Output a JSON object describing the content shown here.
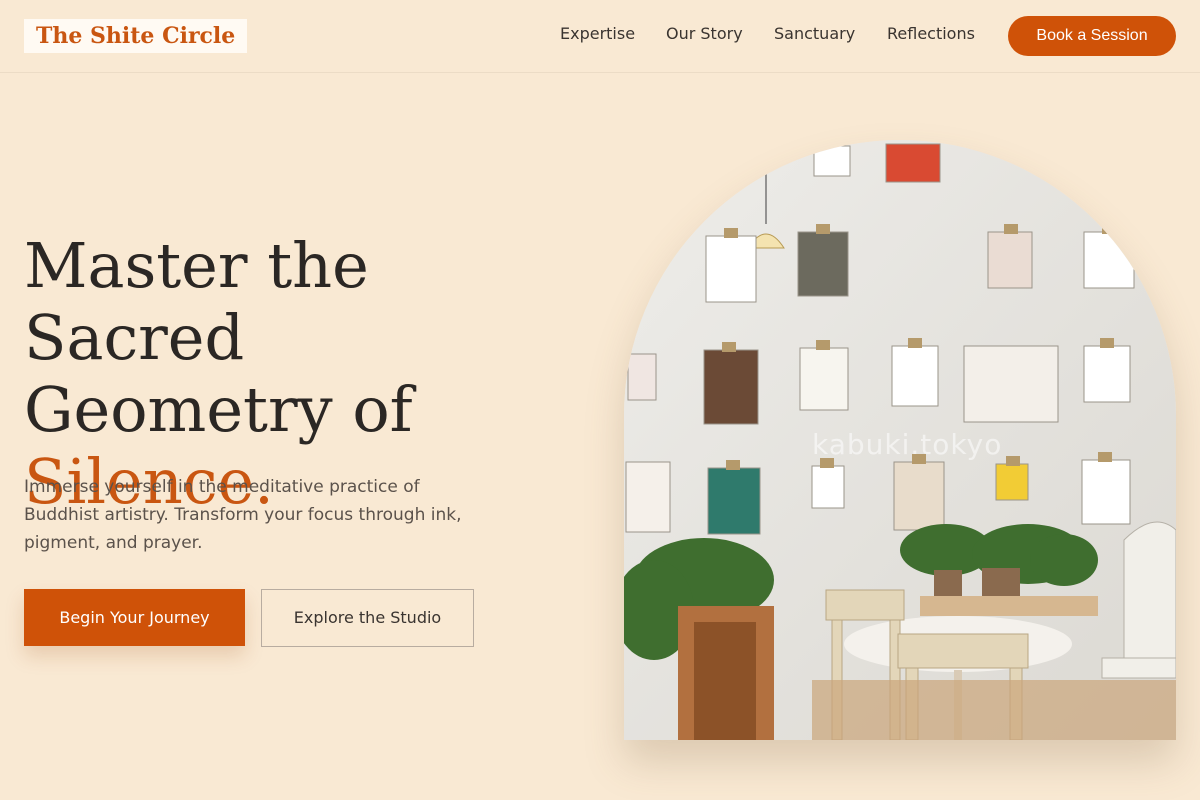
{
  "brand": {
    "name": "The Shite Circle"
  },
  "nav": {
    "links": [
      "Expertise",
      "Our Story",
      "Sanctuary",
      "Reflections"
    ],
    "cta_label": "Book a Session"
  },
  "hero": {
    "headline_line1": "Master the Sacred",
    "headline_line2": "Geometry of",
    "headline_accent": "Silence.",
    "lede": "Immerse yourself in the meditative practice of Buddhist artistry. Transform your focus through ink, pigment, and prayer.",
    "primary_cta": "Begin Your Journey",
    "secondary_cta": "Explore the Studio",
    "image_watermark": "kabuki.tokyo"
  },
  "colors": {
    "background": "#f9e9d3",
    "accent": "#cf5208",
    "text": "#2b2724"
  }
}
